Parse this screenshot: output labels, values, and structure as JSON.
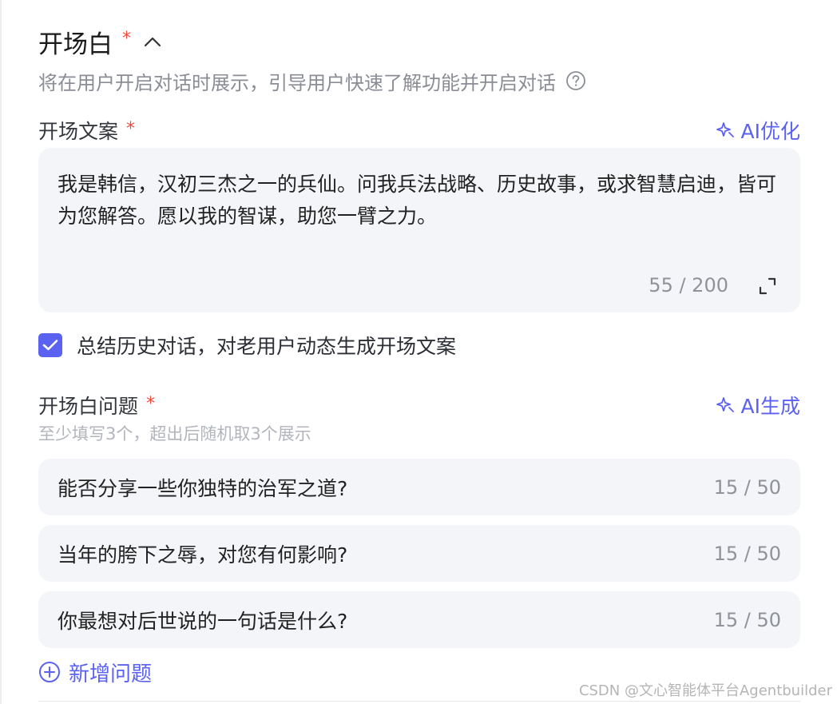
{
  "section": {
    "title": "开场白",
    "required_mark": "*",
    "subtitle": "将在用户开启对话时展示，引导用户快速了解功能并开启对话"
  },
  "opening_copy": {
    "label": "开场文案",
    "required_mark": "*",
    "ai_action": "AI优化",
    "text": "我是韩信，汉初三杰之一的兵仙。问我兵法战略、历史故事，或求智慧启迪，皆可为您解答。愿以我的智谋，助您一臂之力。",
    "count": "55 / 200"
  },
  "checkbox": {
    "checked": true,
    "label": "总结历史对话，对老用户动态生成开场文案"
  },
  "questions": {
    "label": "开场白问题",
    "required_mark": "*",
    "ai_action": "AI生成",
    "hint": "至少填写3个，超出后随机取3个展示",
    "items": [
      {
        "text": "能否分享一些你独特的治军之道?",
        "count": "15 / 50"
      },
      {
        "text": "当年的胯下之辱，对您有何影响?",
        "count": "15 / 50"
      },
      {
        "text": "你最想对后世说的一句话是什么?",
        "count": "15 / 50"
      }
    ],
    "add_label": "新增问题"
  },
  "watermark": "CSDN @文心智能体平台Agentbuilder",
  "colors": {
    "accent": "#5b62f2",
    "required": "#f04a3e",
    "field_bg": "#f4f5f8",
    "muted_text": "#8a8d95"
  },
  "icons": [
    "chevron-up-icon",
    "help-circle-icon",
    "sparkle-icon",
    "expand-icon",
    "check-icon",
    "plus-circle-icon"
  ]
}
